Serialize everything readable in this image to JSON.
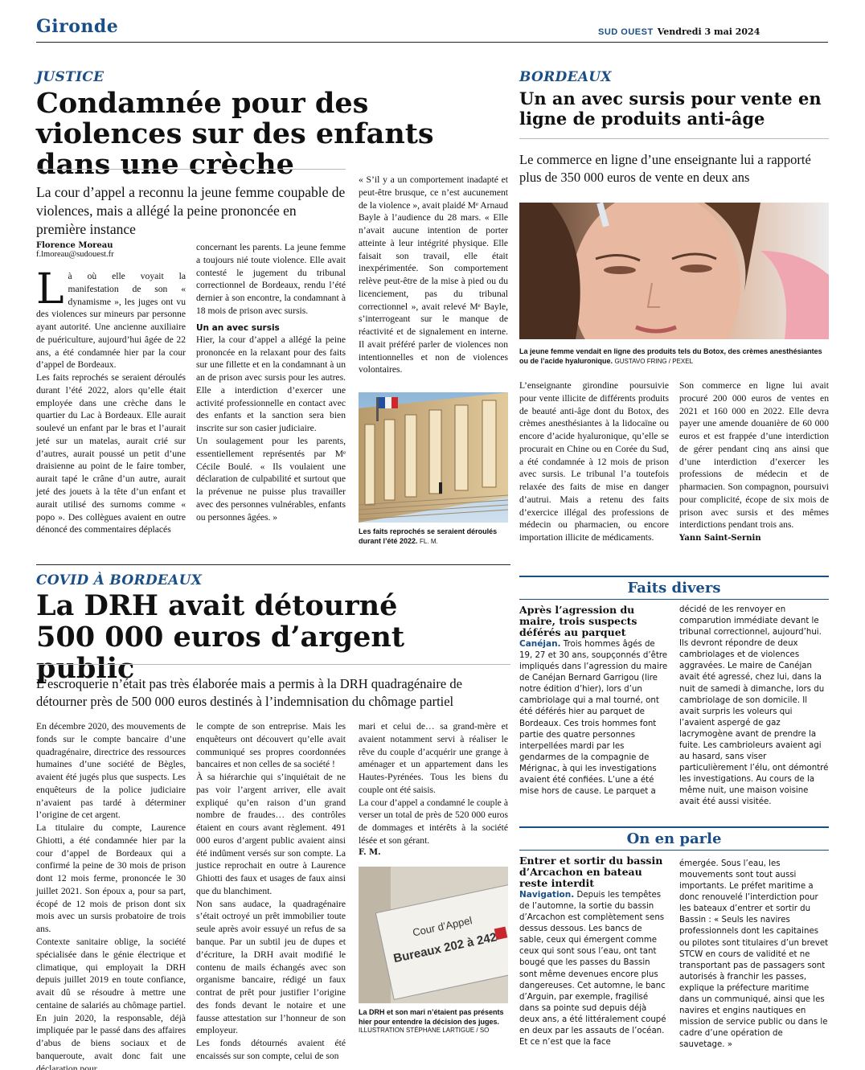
{
  "header": {
    "section": "Gironde",
    "brand": "SUD OUEST",
    "date": "Vendredi 3 mai 2024"
  },
  "article1": {
    "rubric": "JUSTICE",
    "headline": "Condamnée pour des violences sur des enfants dans une crèche",
    "chapo": "La cour d’appel a reconnu la jeune femme coupable de violences, mais a allégé la peine prononcée en première instance",
    "author": "Florence Moreau",
    "email": "f.lmoreau@sudouest.fr",
    "dropcap": "L",
    "col1": "à où elle voyait la manifestation de son « dynamisme », les juges ont vu des violences sur mineurs par personne ayant autorité. Une ancienne auxiliaire de puériculture, aujourd’hui âgée de 22 ans, a été condamnée hier par la cour d’appel de Bordeaux.",
    "col1b": "Les faits reprochés se seraient déroulés durant l’été 2022, alors qu’elle était employée dans une crèche dans le quartier du Lac à Bordeaux. Elle aurait soulevé un enfant par le bras et l’aurait jeté sur un matelas, aurait crié sur d’autres, aurait poussé un petit d’une draisienne au point de le faire tomber, aurait tapé le crâne d’un autre, aurait jeté des jouets à la tête d’un enfant et aurait utilisé des surnoms comme « popo ». Des collègues avaient en outre dénoncé des commentaires déplacés",
    "col2a": "concernant les parents. La jeune femme a toujours nié toute violence. Elle avait contesté le jugement du tribunal correctionnel de Bordeaux, rendu l’été dernier à son encontre, la condamnant à 18 mois de prison avec sursis.",
    "subhead": "Un an avec sursis",
    "col2b": "Hier, la cour d’appel a allégé la peine prononcée en la relaxant pour des faits sur une fillette et en la condamnant à un an de prison avec sursis pour les autres. Elle a interdiction d’exercer une activité professionnelle en contact avec des enfants et la sanction sera bien inscrite sur son casier judiciaire.",
    "col2c": "Un soulagement pour les parents, essentiellement représentés par Mᵉ Cécile Boulé. « Ils voulaient une déclaration de culpabilité et surtout que la prévenue ne puisse plus travailler avec des personnes vulnérables, enfants ou personnes âgées. »",
    "col3": "« S’il y a un comportement inadapté et peut-être brusque, ce n’est aucunement de la violence », avait plaidé Mᵉ Arnaud Bayle à l’audience du 28 mars. « Elle n’avait aucune intention de porter atteinte à leur intégrité physique. Elle faisait son travail, elle était inexpérimentée. Son comportement relève peut-être de la mise à pied ou du licenciement, pas du tribunal correctionnel », avait relevé Mᵉ Bayle, s’interrogeant sur le manque de réactivité et de signalement en interne. Il avait préféré parler de violences non intentionnelles et non de violences volontaires.",
    "caption": "Les faits reprochés se seraient déroulés durant l’été 2022.",
    "caption_credit": "FL. M."
  },
  "article2": {
    "rubric": "BORDEAUX",
    "headline": "Un an avec sursis pour vente en ligne de produits anti-âge",
    "chapo": "Le commerce en ligne d’une enseignante lui a rapporté plus de 350 000 euros de vente en deux ans",
    "caption": "La jeune femme vendait en ligne des produits tels du Botox, des crèmes anesthésiantes ou de l’acide hyaluronique.",
    "caption_credit": "GUSTAVO FRING / PEXEL",
    "col1": "L’enseignante girondine poursuivie pour vente illicite de différents produits de beauté anti-âge dont du Botox, des crèmes anesthésiantes à la lidocaïne ou encore d’acide hyaluronique, qu’elle se procurait en Chine ou en Corée du Sud, a été condamnée à 12 mois de prison avec sursis. Le tribunal l’a toutefois relaxée des faits de mise en danger d’autrui. Mais a retenu des faits d’exercice illégal des professions de médecin ou pharmacien, ou encore importation illicite de médicaments.",
    "col2": "Son commerce en ligne lui avait procuré 200 000 euros de ventes en 2021 et 160 000 en 2022. Elle devra payer une amende douanière de 60 000 euros et est frappée d’une interdiction de gérer pendant cinq ans ainsi que d’une interdiction d’exercer les professions de médecin et de pharmacien. Son compagnon, poursuivi pour complicité, écope de six mois de prison avec sursis et des mêmes interdictions pendant trois ans.",
    "author": "Yann Saint-Sernin"
  },
  "article3": {
    "rubric": "COVID À BORDEAUX",
    "headline_line1": "La DRH avait détourné",
    "headline_line2": "500 000 euros d’argent public",
    "chapo": "L’escroquerie n’était pas très élaborée mais a permis à la DRH quadragénaire de détourner près de 500 000 euros destinés à l’indemnisation du chômage partiel",
    "col1a": "En décembre 2020, des mouvements de fonds sur le compte bancaire d’une quadragénaire, directrice des ressources humaines d’une société de Bègles, avaient été jugés plus que suspects. Les enquêteurs de la police judiciaire n’avaient pas tardé à déterminer l’origine de cet argent.",
    "col1b": "La titulaire du compte, Laurence Ghiotti, a été condamnée hier par la cour d’appel de Bordeaux qui a confirmé la peine de 30 mois de prison dont 12 mois ferme, prononcée le 30 juillet 2021. Son époux a, pour sa part, écopé de 12 mois de prison dont six mois avec un sursis probatoire de trois ans.",
    "col1c": "Contexte sanitaire oblige, la société spécialisée dans le génie électrique et climatique, qui employait la DRH depuis juillet 2019 en toute confiance, avait dû se résoudre à mettre une centaine de salariés au chômage partiel. En juin 2020, la responsable, déjà impliquée par le passé dans des affaires d’abus de biens sociaux et de banqueroute, avait donc fait une déclaration pour",
    "col2a": "le compte de son entreprise. Mais les enquêteurs ont découvert qu’elle avait communiqué ses propres coordonnées bancaires et non celles de sa société !",
    "col2b": "À sa hiérarchie qui s’inquiétait de ne pas voir l’argent arriver, elle avait expliqué qu’en raison d’un grand nombre de fraudes… des contrôles étaient en cours avant règlement. 491 000 euros d’argent public avaient ainsi été indûment versés sur son compte. La justice reprochait en outre à Laurence Ghiotti des faux et usages de faux ainsi que du blanchiment.",
    "col2c": "Non sans audace, la quadragénaire s’était octroyé un prêt immobilier toute seule après avoir essuyé un refus de sa banque. Par un subtil jeu de dupes et d’écriture, la DRH avait modifié le contenu de mails échangés avec son organisme bancaire, rédigé un faux contrat de prêt pour justifier l’origine des fonds devant le notaire et une fausse attestation sur l’honneur de son employeur.",
    "col2d": "Les fonds détournés avaient été encaissés sur son compte, celui de son",
    "col3": "mari et celui de… sa grand-mère et avaient notamment servi à réaliser le rêve du couple d’acquérir une grange à aménager et un appartement dans les Hautes-Pyrénées. Tous les biens du couple ont été saisis.",
    "col3b": "La cour d’appel a condamné le couple à verser un total de près de 520 000 euros de dommages et intérêts à la société lésée et son gérant.",
    "author": "F. M.",
    "sign_line1": "Cour d’Appel",
    "sign_line2": "Bureaux 202 à 242",
    "caption": "La DRH et son mari n’étaient pas présents hier pour entendre la décision des juges.",
    "caption_credit": "ILLUSTRATION STÉPHANE LARTIGUE / SO"
  },
  "faits_divers": {
    "header": "Faits divers",
    "title": "Après l’agression du maire, trois suspects déférés au parquet",
    "lead": "Canéjan.",
    "col1": "Trois hommes âgés de 19, 27 et 30 ans, soupçonnés d’être impliqués dans l’agression du maire de Canéjan Bernard Garrigou (lire notre édition d’hier), lors d’un cambriolage qui a mal tourné, ont été déférés hier au parquet de Bordeaux. Ces trois hommes font partie des quatre personnes interpellées mardi par les gendarmes de la compagnie de Mérignac, à qui les investigations avaient été confiées. L’une a été mise hors de cause. Le parquet a",
    "col2": "décidé de les renvoyer en comparution immédiate devant le tribunal correctionnel, aujourd’hui. Ils devront répondre de deux cambriolages et de violences aggravées. Le maire de Canéjan avait été agressé, chez lui, dans la nuit de samedi à dimanche, lors du cambriolage de son domicile. Il avait surpris les voleurs qui l’avaient aspergé de gaz lacrymogène avant de prendre la fuite. Les cambrioleurs avaient agi au hasard, sans viser particulièrement l’élu, ont démontré les investigations. Au cours de la même nuit, une maison voisine avait été aussi visitée."
  },
  "on_en_parle": {
    "header": "On en parle",
    "title": "Entrer et sortir du bassin d’Arcachon en bateau reste interdit",
    "lead": "Navigation.",
    "col1": "Depuis les tempêtes de l’automne, la sortie du bassin d’Arcachon est complètement sens dessus dessous. Les bancs de sable, ceux qui émergent comme ceux qui sont sous l’eau, ont tant bougé que les passes du Bassin sont même devenues encore plus dangereuses. Cet automne, le banc d’Arguin, par exemple, fragilisé dans sa pointe sud depuis déjà deux ans, a été littéralement coupé en deux par les assauts de l’océan. Et ce n’est que la face",
    "col2": "émergée. Sous l’eau, les mouvements sont tout aussi importants. Le préfet maritime a donc renouvelé l’interdiction pour les bateaux d’entrer et sortir du Bassin : « Seuls les navires professionnels dont les capitaines ou pilotes sont titulaires d’un brevet STCW en cours de validité et ne transportant pas de passagers sont autorisés à franchir les passes, explique la préfecture maritime dans un communiqué, ainsi que les navires et engins nautiques en mission de service public ou dans le cadre d’une opération de sauvetage. »"
  }
}
